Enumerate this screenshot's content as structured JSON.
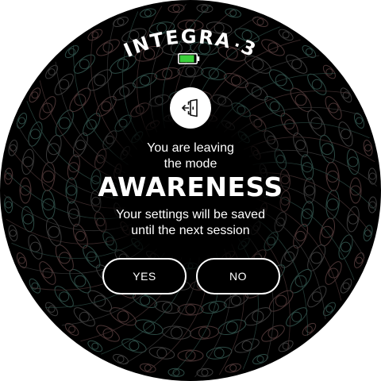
{
  "header": {
    "brand_name": "INTEGRA",
    "brand_number": "3",
    "battery": {
      "level": 0.9,
      "color": "#3bd13b"
    }
  },
  "dialog": {
    "exit_icon": "door-exit-icon",
    "line1": "You are leaving",
    "line2": "the mode",
    "mode_name": "AWARENESS",
    "note_line1": "Your settings will be saved",
    "note_line2": "until the next session",
    "yes_label": "YES",
    "no_label": "NO"
  },
  "theme": {
    "background": "#000000",
    "foreground": "#ffffff",
    "pattern_colors": [
      "#2c4a44",
      "#4a3434",
      "#3b3b3b"
    ]
  }
}
